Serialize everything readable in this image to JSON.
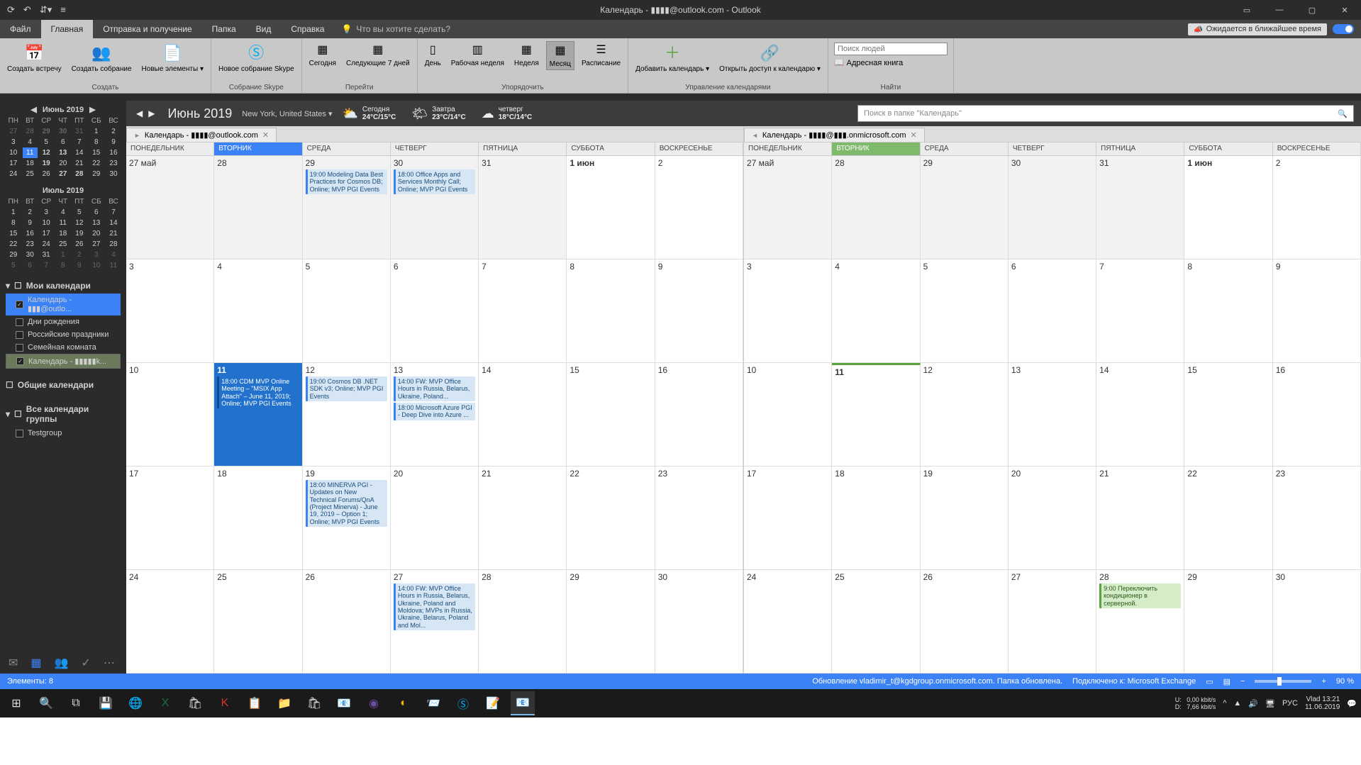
{
  "title": "Календарь - ▮▮▮▮@outlook.com - Outlook",
  "menu": {
    "file": "Файл",
    "home": "Главная",
    "sendrecv": "Отправка и получение",
    "folder": "Папка",
    "view": "Вид",
    "help": "Справка",
    "tell": "Что вы хотите сделать?",
    "status_right": "Ожидается в ближайшее время"
  },
  "ribbon": {
    "create": {
      "meeting": "Создать встречу",
      "gathering": "Создать собрание",
      "elements": "Новые элементы ▾",
      "label": "Создать"
    },
    "skype": {
      "btn": "Новое собрание Skype",
      "label": "Собрание Skype"
    },
    "goto": {
      "today": "Сегодня",
      "next7": "Следующие 7 дней",
      "label": "Перейти"
    },
    "arrange": {
      "day": "День",
      "workweek": "Рабочая неделя",
      "week": "Неделя",
      "month": "Месяц",
      "schedule": "Расписание",
      "label": "Упорядочить"
    },
    "manage": {
      "add": "Добавить календарь ▾",
      "share": "Открыть доступ к календарю ▾",
      "label": "Управление календарями"
    },
    "find": {
      "placeholder": "Поиск людей",
      "addressbook": "Адресная книга",
      "label": "Найти"
    }
  },
  "calhdr": {
    "month": "Июнь 2019",
    "location": "New York, United States  ▾",
    "w1_day": "Сегодня",
    "w1_temp": "24°C/15°C",
    "w2_day": "Завтра",
    "w2_temp": "23°C/14°C",
    "w3_day": "четверг",
    "w3_temp": "18°C/14°C",
    "search_placeholder": "Поиск в папке \"Календарь\""
  },
  "mini": {
    "m1": "Июнь 2019",
    "m2": "Июль 2019",
    "dow": [
      "ПН",
      "ВТ",
      "СР",
      "ЧТ",
      "ПТ",
      "СБ",
      "ВС"
    ]
  },
  "sidebar": {
    "mycal": "Мои календари",
    "c1": "Календарь - ▮▮▮@outlo...",
    "c2": "Дни рождения",
    "c3": "Российские праздники",
    "c4": "Семейная комната",
    "c5": "Календарь - ▮▮▮▮▮k...",
    "shared": "Общие календари",
    "group": "Все календари группы",
    "g1": "Testgroup"
  },
  "tabs": {
    "left": "Календарь - ▮▮▮▮@outlook.com",
    "right": "Календарь - ▮▮▮▮@▮▮▮.onmicrosoft.com"
  },
  "dow_full": [
    "ПОНЕДЕЛЬНИК",
    "ВТОРНИК",
    "СРЕДА",
    "ЧЕТВЕРГ",
    "ПЯТНИЦА",
    "СУББОТА",
    "ВОСКРЕСЕНЬЕ"
  ],
  "dates": {
    "r1": [
      "27 май",
      "28",
      "29",
      "30",
      "31",
      "1 июн",
      "2"
    ],
    "r2": [
      "3",
      "4",
      "5",
      "6",
      "7",
      "8",
      "9"
    ],
    "r3": [
      "10",
      "11",
      "12",
      "13",
      "14",
      "15",
      "16"
    ],
    "r4": [
      "17",
      "18",
      "19",
      "20",
      "21",
      "22",
      "23"
    ],
    "r5": [
      "24",
      "25",
      "26",
      "27",
      "28",
      "29",
      "30"
    ]
  },
  "events": {
    "e29": "19:00 Modeling Data Best Practices for Cosmos DB; Online; MVP PGI Events",
    "e30": "18:00 Office Apps and Services Monthly Call; Online; MVP PGI Events",
    "e11": "18:00 CDM MVP Online Meeting – \"MSIX App Attach\" – June 11, 2019; Online; MVP PGI Events",
    "e12": "19:00 Cosmos DB .NET SDK v3; Online; MVP PGI Events",
    "e13a": "14:00 FW: MVP Office Hours in Russia, Belarus, Ukraine, Poland...",
    "e13b": "18:00 Microsoft Azure PGI - Deep Dive into Azure ...",
    "e19": "18:00 MINERVA PGI - Updates on New Technical Forums/QnA (Project Minerva) - June 19, 2019 – Option 1; Online; MVP PGI Events",
    "e27": "14:00 FW: MVP Office Hours in Russia, Belarus, Ukraine, Poland and Moldova; MVPs in Russia, Ukraine, Belarus, Poland and Mol...",
    "e28r": "9:00 Переключить кондиционер в серверной."
  },
  "status": {
    "items": "Элементы: 8",
    "update": "Обновление vladimir_t@kgdgroup.onmicrosoft.com.  Папка обновлена.",
    "conn": "Подключено к: Microsoft Exchange",
    "zoom": "90 %"
  },
  "tray": {
    "net": "U:   0,00 kbit/s\nD:   7,66 kbit/s",
    "lang": "РУС",
    "time": "Vlad 13:21\n11.06.2019"
  }
}
